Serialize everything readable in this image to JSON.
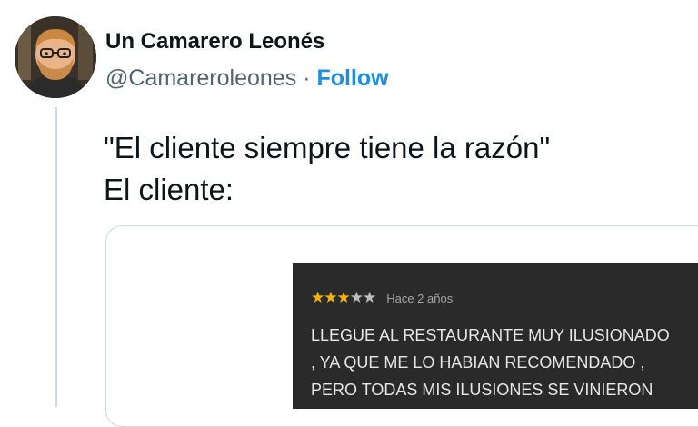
{
  "tweet": {
    "author": {
      "display_name": "Un Camarero Leonés",
      "handle": "@Camareroleones",
      "separator": "·",
      "follow_label": "Follow"
    },
    "text_lines": [
      "\"El cliente siempre tiene la razón\"",
      "El cliente:"
    ],
    "media": {
      "review": {
        "stars_filled": "★★★",
        "stars_empty": "★★",
        "rating": 3,
        "rating_max": 5,
        "date": "Hace 2 años",
        "lines": [
          "LLEGUE AL RESTAURANTE MUY ILUSIONADO",
          ", YA QUE ME LO HABIAN RECOMENDADO ,",
          "PERO TODAS MIS ILUSIONES SE VINIERON"
        ]
      }
    }
  },
  "colors": {
    "follow": "#1d8fe0",
    "star_filled": "#f5b400",
    "review_background": "#2a2a2a"
  }
}
